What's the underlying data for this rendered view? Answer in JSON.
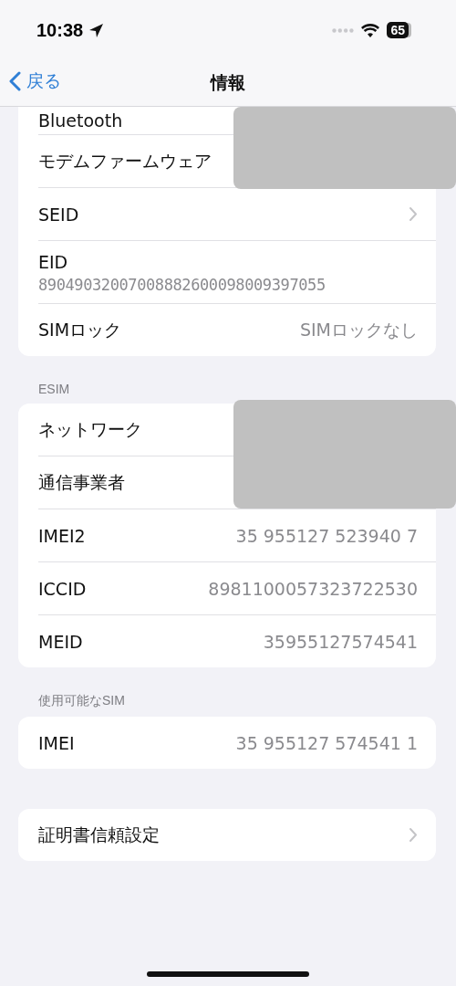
{
  "status_bar": {
    "time": "10:38",
    "battery": "65"
  },
  "nav": {
    "back": "戻る",
    "title": "情報"
  },
  "sections": [
    {
      "redacted": true,
      "rows": [
        {
          "kind": "value",
          "label": "Bluetooth"
        },
        {
          "kind": "value",
          "label": "モデムファームウェア"
        },
        {
          "kind": "link",
          "label": "SEID"
        },
        {
          "kind": "stacked",
          "label": "EID",
          "value": "89049032007008882600098009397055"
        },
        {
          "kind": "value",
          "label": "SIMロック",
          "value": "SIMロックなし"
        }
      ]
    },
    {
      "header": "ESIM",
      "redacted": true,
      "rows": [
        {
          "kind": "value",
          "label": "ネットワーク"
        },
        {
          "kind": "value",
          "label": "通信事業者"
        },
        {
          "kind": "value",
          "label": "IMEI2",
          "value": "35 955127 523940 7"
        },
        {
          "kind": "value",
          "label": "ICCID",
          "value": "8981100057323722530"
        },
        {
          "kind": "value",
          "label": "MEID",
          "value": "35955127574541"
        }
      ]
    },
    {
      "header": "使用可能なSIM",
      "rows": [
        {
          "kind": "value",
          "label": "IMEI",
          "value": "35 955127 574541 1"
        }
      ]
    },
    {
      "rows": [
        {
          "kind": "link",
          "label": "証明書信頼設定"
        }
      ]
    }
  ]
}
